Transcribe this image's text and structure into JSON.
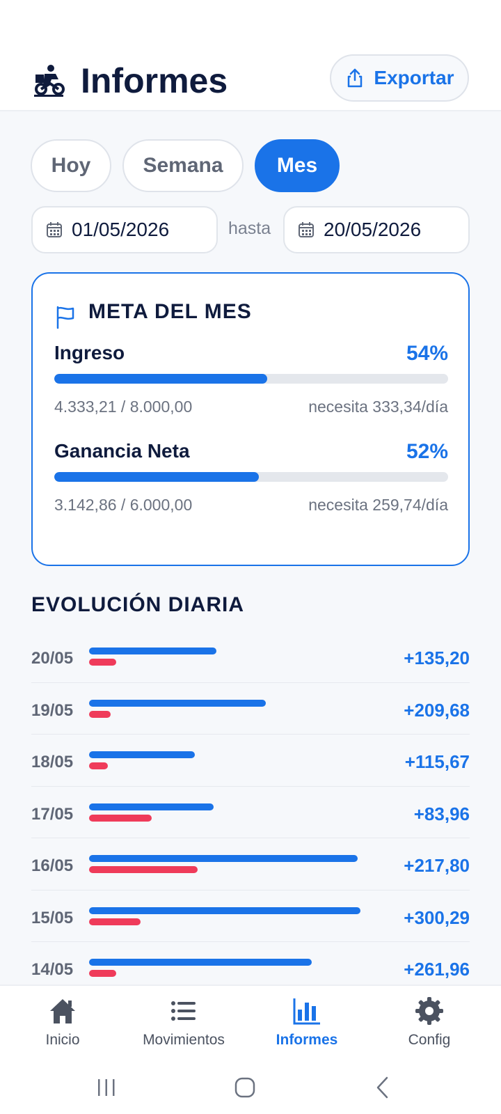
{
  "header": {
    "title": "Informes",
    "export_label": "Exportar"
  },
  "segments": [
    {
      "label": "Hoy",
      "active": false
    },
    {
      "label": "Semana",
      "active": false
    },
    {
      "label": "Mes",
      "active": true
    }
  ],
  "range": {
    "from": "01/05/2026",
    "separator": "hasta",
    "to": "20/05/2026"
  },
  "goal": {
    "title": "META DEL MES",
    "rows": [
      {
        "label": "Ingreso",
        "pct_label": "54%",
        "progress": 0.54,
        "amount": "4.333,21 / 8.000,00",
        "need": "necesita 333,34/día"
      },
      {
        "label": "Ganancia Neta",
        "pct_label": "52%",
        "progress": 0.52,
        "amount": "3.142,86 / 6.000,00",
        "need": "necesita 259,74/día"
      }
    ]
  },
  "daily": {
    "title": "EVOLUCIÓN DIARIA",
    "rows": [
      {
        "date": "20/05",
        "value": "+135,20",
        "income_level": 0.47,
        "expense_level": 0.1
      },
      {
        "date": "19/05",
        "value": "+209,68",
        "income_level": 0.65,
        "expense_level": 0.08
      },
      {
        "date": "18/05",
        "value": "+115,67",
        "income_level": 0.39,
        "expense_level": 0.07
      },
      {
        "date": "17/05",
        "value": "+83,96",
        "income_level": 0.46,
        "expense_level": 0.23
      },
      {
        "date": "16/05",
        "value": "+217,80",
        "income_level": 0.99,
        "expense_level": 0.4
      },
      {
        "date": "15/05",
        "value": "+300,29",
        "income_level": 1.0,
        "expense_level": 0.19
      },
      {
        "date": "14/05",
        "value": "+261,96",
        "income_level": 0.82,
        "expense_level": 0.1
      }
    ]
  },
  "nav": [
    {
      "label": "Inicio",
      "icon": "home-icon",
      "active": false
    },
    {
      "label": "Movimientos",
      "icon": "list-icon",
      "active": false
    },
    {
      "label": "Informes",
      "icon": "bar-chart-icon",
      "active": true
    },
    {
      "label": "Config",
      "icon": "gear-icon",
      "active": false
    }
  ],
  "colors": {
    "accent": "#1a73e8",
    "expense": "#ef3b5a",
    "text_dark": "#0f1b3d",
    "muted": "#6b7280"
  }
}
